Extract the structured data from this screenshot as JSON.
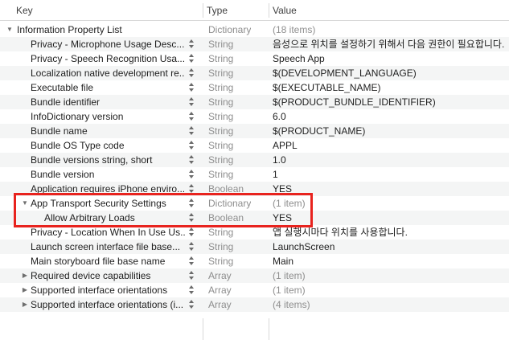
{
  "columns": {
    "key": "Key",
    "type": "Type",
    "value": "Value"
  },
  "root": {
    "key": "Information Property List",
    "type": "Dictionary",
    "value": "(18 items)"
  },
  "rows": [
    {
      "key": "Privacy - Microphone Usage Desc...",
      "type": "String",
      "value": "음성으로 위치를 설정하기 위해서 다음 권한이 필요합니다."
    },
    {
      "key": "Privacy - Speech Recognition Usa...",
      "type": "String",
      "value": "Speech App"
    },
    {
      "key": "Localization native development re...",
      "type": "String",
      "value": "$(DEVELOPMENT_LANGUAGE)"
    },
    {
      "key": "Executable file",
      "type": "String",
      "value": "$(EXECUTABLE_NAME)"
    },
    {
      "key": "Bundle identifier",
      "type": "String",
      "value": "$(PRODUCT_BUNDLE_IDENTIFIER)"
    },
    {
      "key": "InfoDictionary version",
      "type": "String",
      "value": "6.0"
    },
    {
      "key": "Bundle name",
      "type": "String",
      "value": "$(PRODUCT_NAME)"
    },
    {
      "key": "Bundle OS Type code",
      "type": "String",
      "value": "APPL"
    },
    {
      "key": "Bundle versions string, short",
      "type": "String",
      "value": "1.0"
    },
    {
      "key": "Bundle version",
      "type": "String",
      "value": "1"
    },
    {
      "key": "Application requires iPhone enviro...",
      "type": "Boolean",
      "value": "YES"
    },
    {
      "key": "App Transport Security Settings",
      "type": "Dictionary",
      "value": "(1 item)"
    },
    {
      "key": "Allow Arbitrary Loads",
      "type": "Boolean",
      "value": "YES"
    },
    {
      "key": "Privacy - Location When In Use Us...",
      "type": "String",
      "value": "앱 실행시마다 위치를 사용합니다."
    },
    {
      "key": "Launch screen interface file base...",
      "type": "String",
      "value": "LaunchScreen"
    },
    {
      "key": "Main storyboard file base name",
      "type": "String",
      "value": "Main"
    },
    {
      "key": "Required device capabilities",
      "type": "Array",
      "value": "(1 item)"
    },
    {
      "key": "Supported interface orientations",
      "type": "Array",
      "value": "(1 item)"
    },
    {
      "key": "Supported interface orientations (i...",
      "type": "Array",
      "value": "(4 items)"
    }
  ],
  "colors": {
    "highlight": "#e8231e",
    "alt_row": "#f4f5f5"
  },
  "icons": {
    "expanded": "disclosure-triangle-down-icon",
    "collapsed": "disclosure-triangle-right-icon",
    "stepper": "up-down-stepper-icon"
  }
}
